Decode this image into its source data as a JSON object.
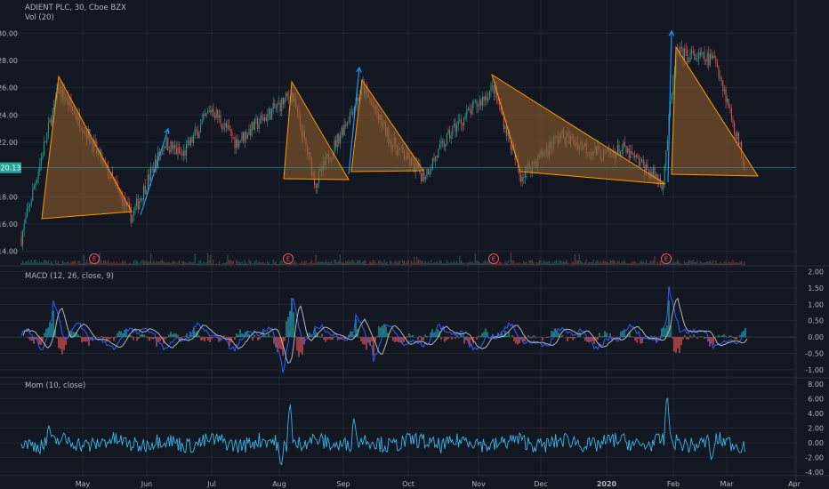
{
  "header": {
    "symbol_line": "ADIENT PLC, 30, Cboe BZX",
    "vol_label": "Vol (20)",
    "macd_label": "MACD (12, 26, close, 9)",
    "mom_label": "Mom (10, close)"
  },
  "colors": {
    "background": "#131722",
    "grid": "#1f2433",
    "candle_up": "#26a69a",
    "candle_down": "#ef5350",
    "triangle_fill": "#8a5a2b",
    "triangle_stroke": "#ff9800",
    "arrow": "#2196f3",
    "price_line": "#26a69a",
    "macd_line": "#2962ff",
    "signal_line": "#b2b5be",
    "momentum": "#3bb3e4",
    "earnings": "#f7525f"
  },
  "price_axis": {
    "ticks": [
      "30.00",
      "28.00",
      "26.00",
      "24.00",
      "22.00",
      "20.00",
      "18.00",
      "16.00",
      "14.00"
    ],
    "current_price": "20.13"
  },
  "macd_axis": {
    "ticks": [
      "2.00",
      "1.50",
      "1.00",
      "0.50",
      "0.00",
      "-0.50",
      "-1.00"
    ]
  },
  "mom_axis": {
    "ticks": [
      "8.00",
      "6.00",
      "4.00",
      "2.00",
      "0.00",
      "-2.00",
      "-4.00"
    ]
  },
  "x_axis": {
    "months": [
      "May",
      "Jun",
      "Jul",
      "Aug",
      "Sep",
      "Oct",
      "Nov",
      "Dec",
      "2020",
      "Feb",
      "Mar",
      "Apr"
    ]
  },
  "earnings_marker": "E",
  "chart_data": {
    "type": "line",
    "title": "ADIENT PLC, 30, Cboe BZX",
    "x": [
      "Apr 2019",
      "Apr 2019",
      "May 2019",
      "May 2019",
      "Jun 2019",
      "Jun 2019",
      "Jul 2019",
      "Jul 2019",
      "Aug 2019",
      "Aug 2019",
      "Sep 2019",
      "Sep 2019",
      "Oct 2019",
      "Oct 2019",
      "Nov 2019",
      "Nov 2019",
      "Dec 2019",
      "Dec 2019",
      "Jan 2020",
      "Jan 2020",
      "Feb 2020",
      "Feb 2020",
      "Mar 2020"
    ],
    "series": [
      {
        "name": "Price",
        "values": [
          15.0,
          26.0,
          23.0,
          16.5,
          22.0,
          21.0,
          24.5,
          22.0,
          25.5,
          19.0,
          26.0,
          22.0,
          19.5,
          23.0,
          26.0,
          19.5,
          22.5,
          21.0,
          21.5,
          19.0,
          28.5,
          28.0,
          20.13
        ]
      }
    ],
    "ylim": [
      13.0,
      30.8
    ],
    "patterns": [
      {
        "type": "triangle",
        "points": [
          [
            "Apr 2019",
            16.2
          ],
          [
            "Apr 2019",
            26.0
          ],
          [
            "May 2019",
            16.6
          ]
        ]
      },
      {
        "type": "triangle",
        "points": [
          [
            "Aug 2019",
            18.8
          ],
          [
            "Aug 2019",
            25.5
          ],
          [
            "Aug 2019",
            18.7
          ]
        ]
      },
      {
        "type": "triangle",
        "points": [
          [
            "Sep 2019",
            19.4
          ],
          [
            "Sep 2019",
            25.8
          ],
          [
            "Oct 2019",
            19.4
          ]
        ]
      },
      {
        "type": "triangle",
        "points": [
          [
            "Nov 2019",
            26.0
          ],
          [
            "Nov 2019",
            19.5
          ],
          [
            "Jan 2020",
            18.5
          ]
        ]
      },
      {
        "type": "triangle",
        "points": [
          [
            "Feb 2020",
            28.0
          ],
          [
            "Feb 2020",
            19.0
          ],
          [
            "Mar 2020",
            19.0
          ]
        ]
      }
    ],
    "indicators": {
      "macd": {
        "name": "MACD (12, 26, close, 9)",
        "ylim": [
          -1.25,
          2.1
        ],
        "peaks": [
          1.25,
          1.5,
          1.1,
          1.75
        ],
        "troughs": [
          -1.0,
          -0.75
        ]
      },
      "momentum": {
        "name": "Mom (10, close)",
        "ylim": [
          -4.5,
          8.5
        ],
        "peaks": [
          2.5,
          5.8,
          3.5,
          7.2
        ],
        "troughs": [
          -3.5,
          -2.5
        ]
      }
    }
  }
}
